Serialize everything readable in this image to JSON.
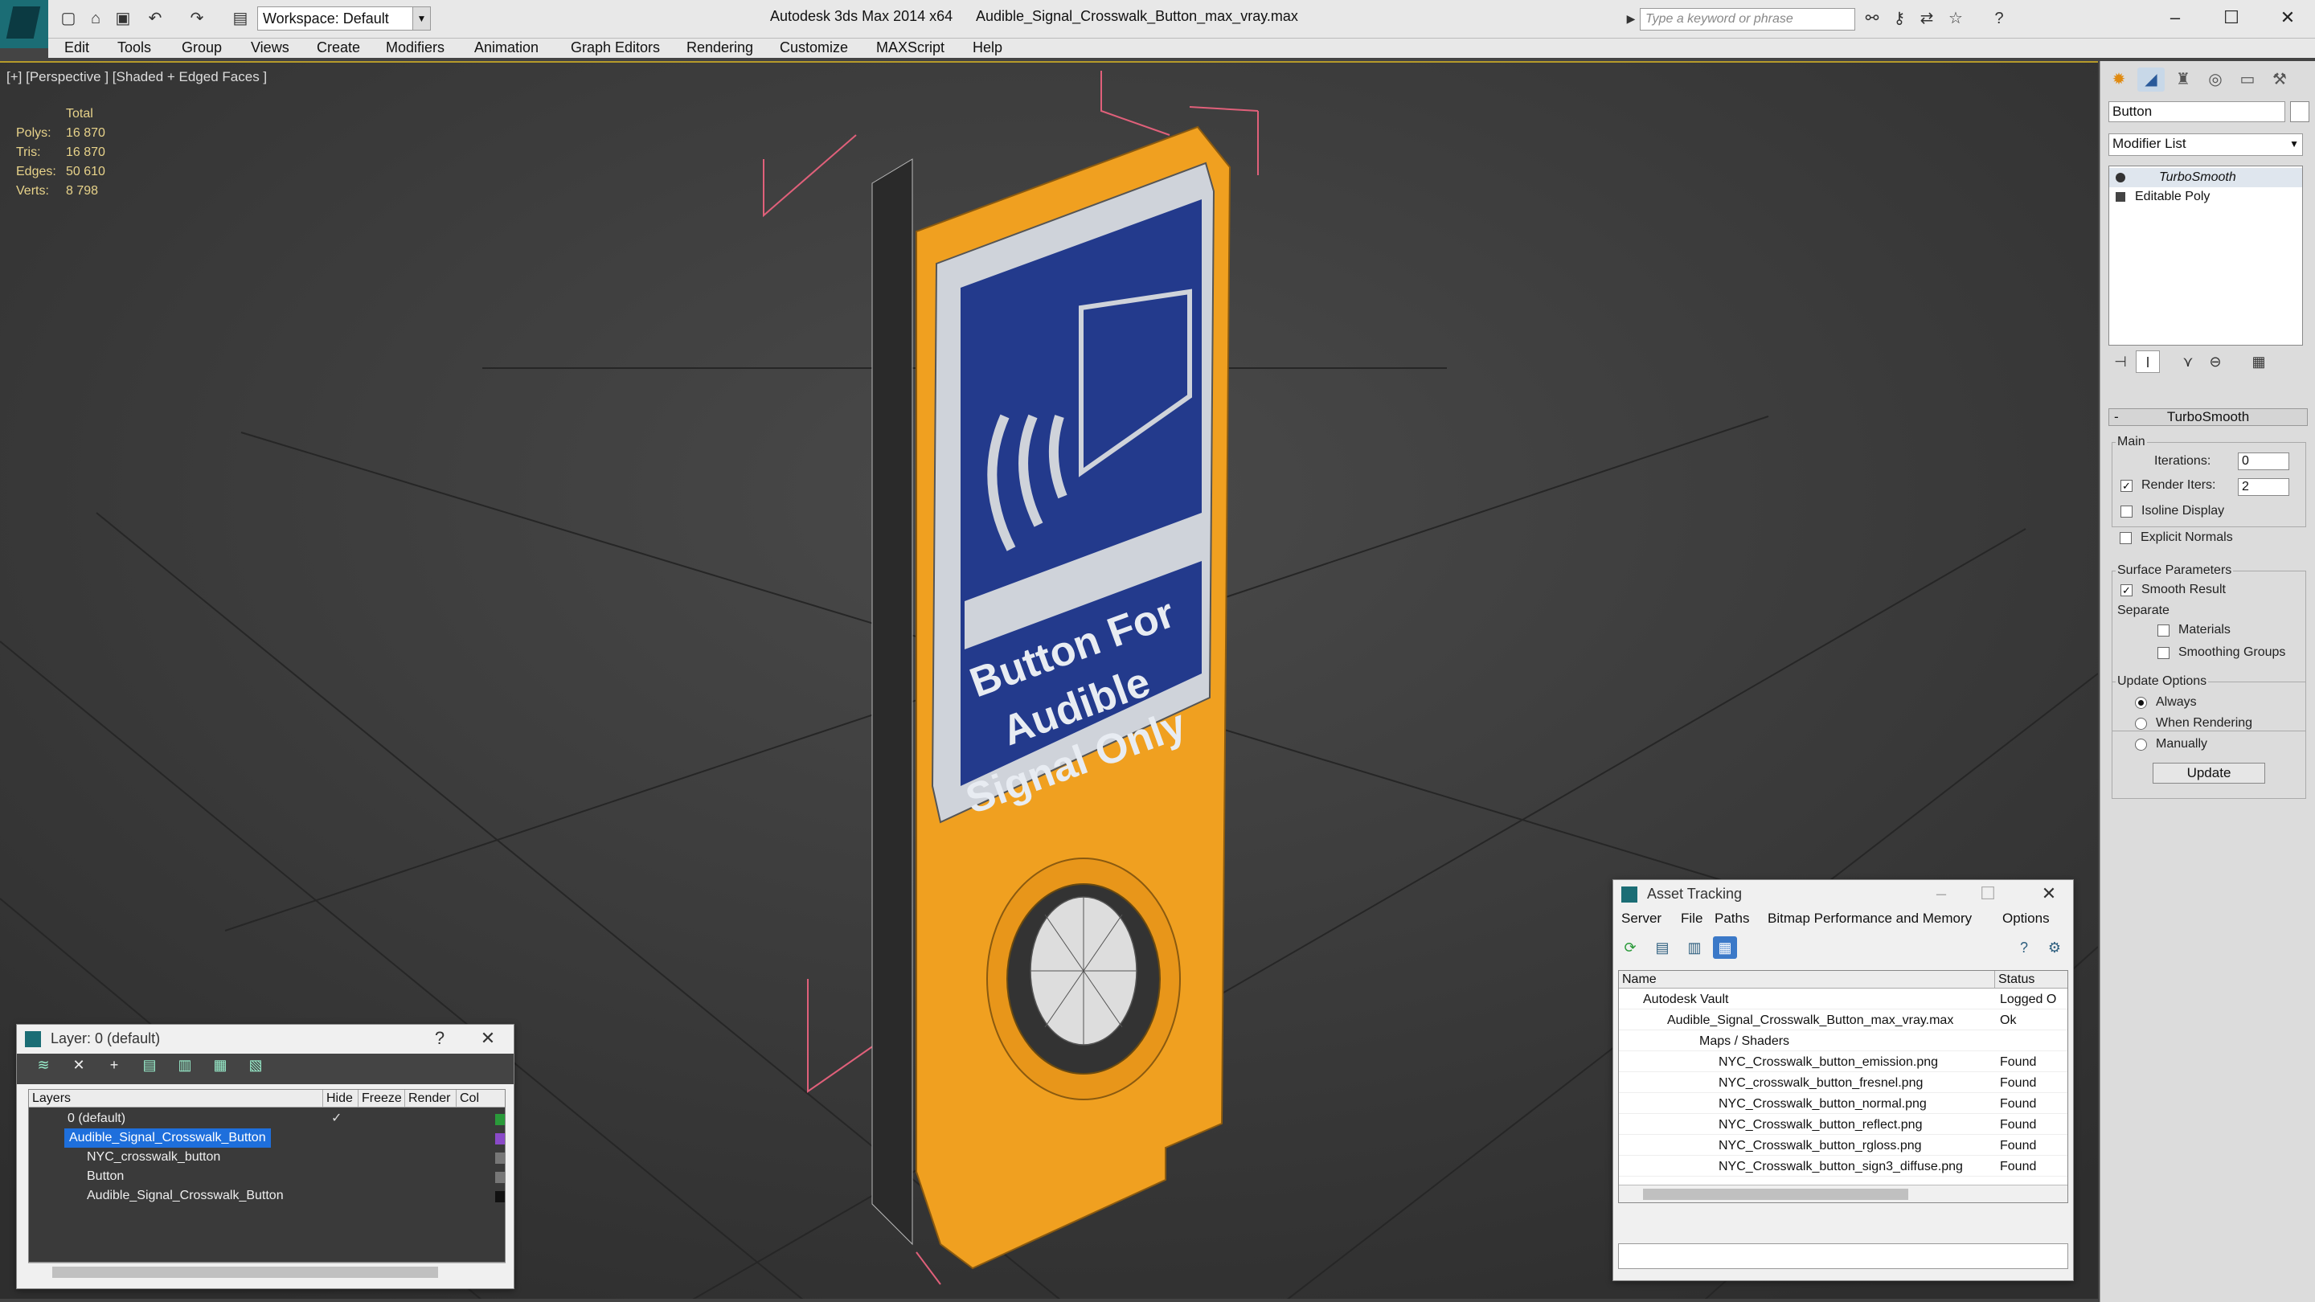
{
  "app": {
    "title": "Autodesk 3ds Max  2014 x64",
    "file": "Audible_Signal_Crosswalk_Button_max_vray.max",
    "workspace": "Workspace: Default",
    "search_placeholder": "Type a keyword or phrase"
  },
  "menu": [
    "Edit",
    "Tools",
    "Group",
    "Views",
    "Create",
    "Modifiers",
    "Animation",
    "Graph Editors",
    "Rendering",
    "Customize",
    "MAXScript",
    "Help"
  ],
  "viewport": {
    "label": "[+] [Perspective ] [Shaded + Edged Faces ]",
    "stats": {
      "header": "Total",
      "rows": [
        {
          "k": "Polys:",
          "v": "16 870"
        },
        {
          "k": "Tris:",
          "v": "16 870"
        },
        {
          "k": "Edges:",
          "v": "50 610"
        },
        {
          "k": "Verts:",
          "v": "8 798"
        }
      ]
    },
    "sign_text": [
      "Button For",
      "Audible",
      "Signal Only"
    ]
  },
  "command_panel": {
    "object_name": "Button",
    "modifier_list": "Modifier List",
    "stack": [
      "TurboSmooth",
      "Editable Poly"
    ],
    "rollout": "TurboSmooth",
    "main_label": "Main",
    "iterations_label": "Iterations:",
    "iterations": "0",
    "render_iters_label": "Render Iters:",
    "render_iters": "2",
    "isoline": "Isoline Display",
    "explicit": "Explicit Normals",
    "surface_label": "Surface Parameters",
    "smooth_result": "Smooth Result",
    "separate": "Separate",
    "materials": "Materials",
    "smoothing_groups": "Smoothing Groups",
    "update_options": "Update Options",
    "always": "Always",
    "when_rendering": "When Rendering",
    "manually": "Manually",
    "update": "Update"
  },
  "layer_dialog": {
    "title": "Layer: 0 (default)",
    "help": "?",
    "columns": [
      "Layers",
      "Hide",
      "Freeze",
      "Render",
      "Col"
    ],
    "rows": [
      {
        "name": "0 (default)",
        "color": "#2a9a3a"
      },
      {
        "name": "Audible_Signal_Crosswalk_Button",
        "color": "#8a4ac8"
      },
      {
        "name": "NYC_crosswalk_button",
        "color": "#777777"
      },
      {
        "name": "Button",
        "color": "#777777"
      },
      {
        "name": "Audible_Signal_Crosswalk_Button",
        "color": "#111111"
      }
    ]
  },
  "asset_dialog": {
    "title": "Asset Tracking",
    "menu": [
      "Server",
      "File",
      "Paths",
      "Bitmap Performance and Memory",
      "Options"
    ],
    "columns": [
      "Name",
      "Status"
    ],
    "rows": [
      {
        "name": "Autodesk Vault",
        "status": "Logged O"
      },
      {
        "name": "Audible_Signal_Crosswalk_Button_max_vray.max",
        "status": "Ok"
      },
      {
        "name": "Maps / Shaders",
        "status": ""
      },
      {
        "name": "NYC_Crosswalk_button_emission.png",
        "status": "Found"
      },
      {
        "name": "NYC_crosswalk_button_fresnel.png",
        "status": "Found"
      },
      {
        "name": "NYC_Crosswalk_button_normal.png",
        "status": "Found"
      },
      {
        "name": "NYC_Crosswalk_button_reflect.png",
        "status": "Found"
      },
      {
        "name": "NYC_Crosswalk_button_rgloss.png",
        "status": "Found"
      },
      {
        "name": "NYC_Crosswalk_button_sign3_diffuse.png",
        "status": "Found"
      }
    ]
  },
  "colors": {
    "accent": "#1e6fdc",
    "sign_blue": "#233a8c",
    "body_orange": "#f0a020",
    "stats_text": "#e8d38a"
  }
}
